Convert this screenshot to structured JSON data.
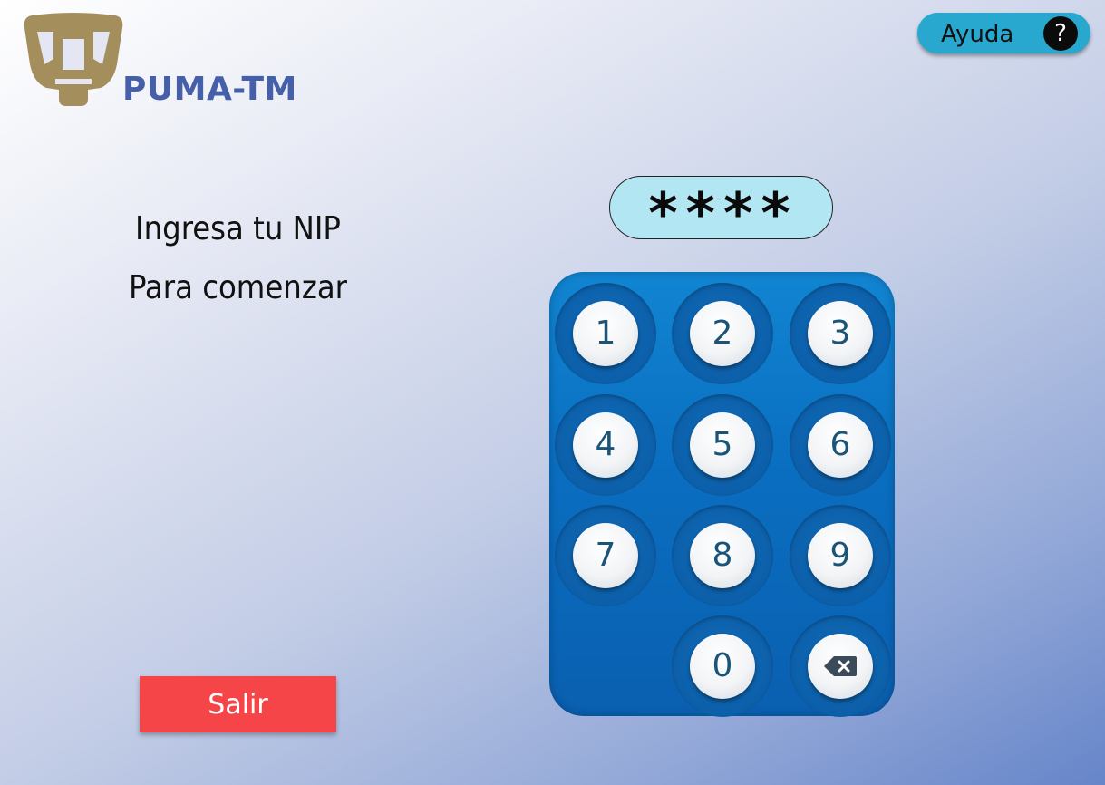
{
  "brand": {
    "name": "PUMA-TM",
    "logo_icon": "puma-logo-icon",
    "logo_color": "#a48f5c",
    "name_color": "#4560a8"
  },
  "help": {
    "label": "Ayuda",
    "icon_glyph": "?",
    "icon": "question-mark-icon",
    "color": "#29a8cf"
  },
  "instructions": {
    "line1": "Ingresa tu NIP",
    "line2": "Para comenzar"
  },
  "pin": {
    "masked_value": "****"
  },
  "keypad": {
    "keys": [
      "1",
      "2",
      "3",
      "4",
      "5",
      "6",
      "7",
      "8",
      "9",
      "0"
    ],
    "backspace_icon": "backspace-icon",
    "color": "#0a6ec0"
  },
  "exit": {
    "label": "Salir",
    "color": "#f64549"
  }
}
